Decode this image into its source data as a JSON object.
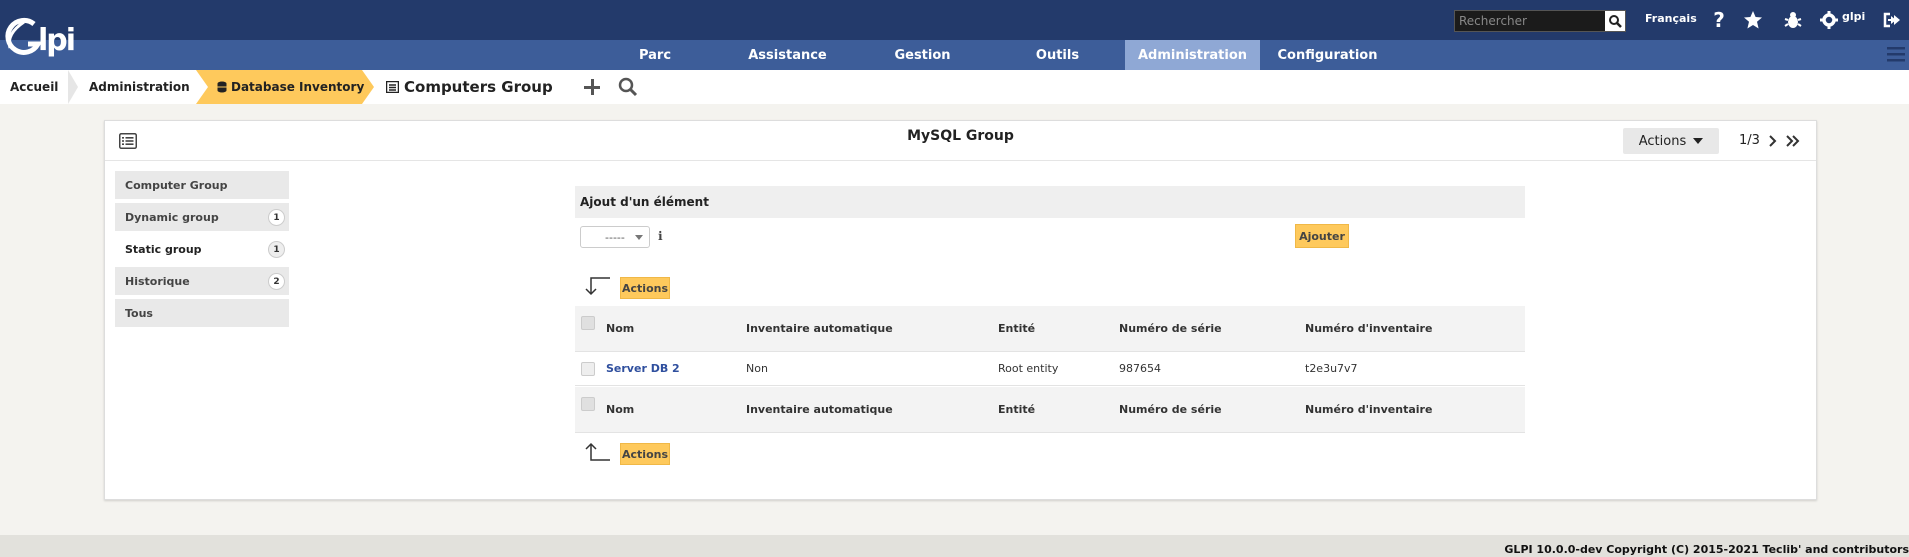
{
  "app": {
    "logo_text": "Glpi",
    "search_placeholder": "Rechercher",
    "language": "Français",
    "username": "glpi",
    "colors": {
      "topbar": "#233a6b",
      "nav": "#3d5d99",
      "nav_active": "#8fa8d5",
      "accent": "#fec95c"
    }
  },
  "nav": {
    "items": [
      {
        "label": "Parc"
      },
      {
        "label": "Assistance"
      },
      {
        "label": "Gestion"
      },
      {
        "label": "Outils"
      },
      {
        "label": "Administration",
        "active": true
      },
      {
        "label": "Configuration"
      }
    ]
  },
  "breadcrumb": {
    "items": [
      "Accueil",
      "Administration",
      "Database Inventory"
    ],
    "page_title": "Computers Group"
  },
  "card": {
    "title": "MySQL Group",
    "actions_label": "Actions",
    "pager": "1/3"
  },
  "tabs": [
    {
      "label": "Computer Group",
      "count": ""
    },
    {
      "label": "Dynamic group",
      "count": "1"
    },
    {
      "label": "Static group",
      "count": "1",
      "active": true
    },
    {
      "label": "Historique",
      "count": "2"
    },
    {
      "label": "Tous",
      "count": ""
    }
  ],
  "add_form": {
    "header": "Ajout d'un élément",
    "select_value": "-----",
    "submit_label": "Ajouter"
  },
  "massive_actions_label": "Actions",
  "table": {
    "columns": [
      "Nom",
      "Inventaire automatique",
      "Entité",
      "Numéro de série",
      "Numéro d'inventaire"
    ],
    "rows": [
      {
        "name": "Server DB 2",
        "auto_inventory": "Non",
        "entity": "Root entity",
        "serial": "987654",
        "inventory_number": "t2e3u7v7"
      }
    ]
  },
  "footer": {
    "text": "GLPI 10.0.0-dev Copyright (C) 2015-2021 Teclib' and contributors"
  }
}
